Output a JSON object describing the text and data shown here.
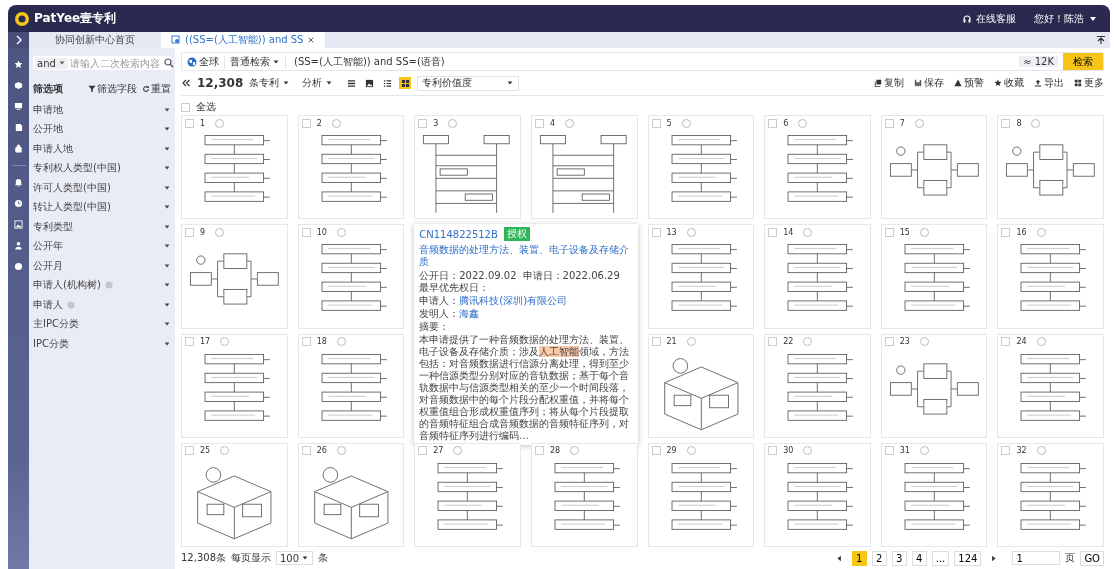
{
  "header": {
    "logo": "PatYee壹专利",
    "support": "在线客服",
    "greeting": "您好！陈浩"
  },
  "tabs": [
    {
      "label": "协同创新中心首页",
      "selected": false,
      "closable": false
    },
    {
      "label": "((SS=(人工智能)) and SS",
      "selected": true,
      "closable": true
    }
  ],
  "filter_panel": {
    "operator": "and",
    "search_placeholder": "请输入二次检索内容",
    "title": "筛选项",
    "field_button": "筛选字段",
    "reset_button": "重置",
    "items": [
      {
        "label": "申请地",
        "info": false
      },
      {
        "label": "公开地",
        "info": false
      },
      {
        "label": "申请人地",
        "info": false
      },
      {
        "label": "专利权人类型(中国)",
        "info": false
      },
      {
        "label": "许可人类型(中国)",
        "info": false
      },
      {
        "label": "转让人类型(中国)",
        "info": false
      },
      {
        "label": "专利类型",
        "info": false
      },
      {
        "label": "公开年",
        "info": false
      },
      {
        "label": "公开月",
        "info": false
      },
      {
        "label": "申请人(机构树)",
        "info": true
      },
      {
        "label": "申请人",
        "info": true
      },
      {
        "label": "主IPC分类",
        "info": false
      },
      {
        "label": "IPC分类",
        "info": false
      }
    ]
  },
  "query": {
    "scope": "全球",
    "mode": "普通检索",
    "text": "(SS=(人工智能)) and SS=(语音)",
    "estimate": "≈ 12K",
    "search_button": "检索"
  },
  "toolbar": {
    "count": "12,308",
    "unit": "条专利",
    "analysis": "分析",
    "views": [
      {
        "selected": false
      },
      {
        "selected": false
      },
      {
        "selected": false
      },
      {
        "selected": true
      }
    ],
    "sort": "专利价值度",
    "actions": [
      {
        "kind": "copy",
        "label": "复制"
      },
      {
        "kind": "save",
        "label": "保存"
      },
      {
        "kind": "alert",
        "label": "预警"
      },
      {
        "kind": "star",
        "label": "收藏"
      },
      {
        "kind": "export",
        "label": "导出"
      },
      {
        "kind": "more",
        "label": "更多"
      }
    ]
  },
  "select_all": {
    "label": "全选",
    "checked": false
  },
  "cards": [
    {
      "number": "1",
      "checked": false,
      "selected": false,
      "kind": "flow"
    },
    {
      "number": "2",
      "checked": false,
      "selected": false,
      "kind": "flow"
    },
    {
      "number": "3",
      "checked": false,
      "selected": false,
      "kind": "seq"
    },
    {
      "number": "4",
      "checked": false,
      "selected": false,
      "kind": "seq"
    },
    {
      "number": "5",
      "checked": false,
      "selected": false,
      "kind": "flow"
    },
    {
      "number": "6",
      "checked": false,
      "selected": false,
      "kind": "flow"
    },
    {
      "number": "7",
      "checked": false,
      "selected": false,
      "kind": "block"
    },
    {
      "number": "8",
      "checked": false,
      "selected": false,
      "kind": "block"
    },
    {
      "number": "9",
      "checked": false,
      "selected": false,
      "kind": "block"
    },
    {
      "number": "10",
      "checked": false,
      "selected": false,
      "kind": "flow"
    },
    {
      "number": "13",
      "checked": false,
      "selected": false,
      "kind": "flow"
    },
    {
      "number": "14",
      "checked": false,
      "selected": false,
      "kind": "flow"
    },
    {
      "number": "15",
      "checked": false,
      "selected": false,
      "kind": "flow"
    },
    {
      "number": "16",
      "checked": false,
      "selected": false,
      "kind": "flow"
    },
    {
      "number": "17",
      "checked": false,
      "selected": false,
      "kind": "flow"
    },
    {
      "number": "18",
      "checked": false,
      "selected": false,
      "kind": "flow"
    },
    {
      "number": "21",
      "checked": false,
      "selected": false,
      "kind": "device"
    },
    {
      "number": "22",
      "checked": false,
      "selected": false,
      "kind": "flow"
    },
    {
      "number": "23",
      "checked": false,
      "selected": false,
      "kind": "block"
    },
    {
      "number": "24",
      "checked": false,
      "selected": false,
      "kind": "flow"
    },
    {
      "number": "25",
      "checked": false,
      "selected": false,
      "kind": "device"
    },
    {
      "number": "26",
      "checked": false,
      "selected": false,
      "kind": "device"
    },
    {
      "number": "27",
      "checked": false,
      "selected": false,
      "kind": "flow"
    },
    {
      "number": "28",
      "checked": false,
      "selected": false,
      "kind": "flow"
    },
    {
      "number": "29",
      "checked": false,
      "selected": false,
      "kind": "flow"
    },
    {
      "number": "30",
      "checked": false,
      "selected": false,
      "kind": "flow"
    },
    {
      "number": "31",
      "checked": false,
      "selected": false,
      "kind": "flow"
    },
    {
      "number": "32",
      "checked": false,
      "selected": false,
      "kind": "flow"
    }
  ],
  "popup": {
    "number": "CN114822512B",
    "status": "授权",
    "title": "音频数据的处理方法、装置、电子设备及存储介质",
    "pub_label": "公开日：",
    "pub_date": "2022.09.02",
    "app_label": "申请日：",
    "app_date": "2022.06.29",
    "priority_label": "最早优先权日：",
    "applicant_label": "申请人：",
    "applicant": "腾讯科技(深圳)有限公司",
    "inventor_label": "发明人：",
    "inventor": "海鑫",
    "abstract_label": "摘要：",
    "abstract": [
      {
        "text": "本申请提供了一种音频数据的处理方法、装置、电子设备及存储介质；涉及",
        "highlight": false
      },
      {
        "text": "人工智能",
        "highlight": true
      },
      {
        "text": "领域，方法包括：对音频数据进行信源分离处理，得到至少一种信源类型分别对应的音轨数据；基于每个音轨数据中与信源类型相关的至少一个时间段落，对音频数据中的每个片段分配权重值，并将每个权重值组合形成权重值序列；将从每个片段提取的音频特征组合成音频数据的音频特征序列，对音频特征序列进行编码...",
        "highlight": false
      }
    ]
  },
  "footer": {
    "total": "12,308条",
    "per_page_label": "每页显示",
    "per_page": "100",
    "per_page_unit": "条",
    "pages": [
      {
        "label": "1",
        "selected": true
      },
      {
        "label": "2",
        "selected": false
      },
      {
        "label": "3",
        "selected": false
      },
      {
        "label": "4",
        "selected": false
      },
      {
        "label": "...",
        "selected": false
      },
      {
        "label": "124",
        "selected": false
      }
    ],
    "page_input": "1",
    "page_unit": "页",
    "go": "GO"
  }
}
